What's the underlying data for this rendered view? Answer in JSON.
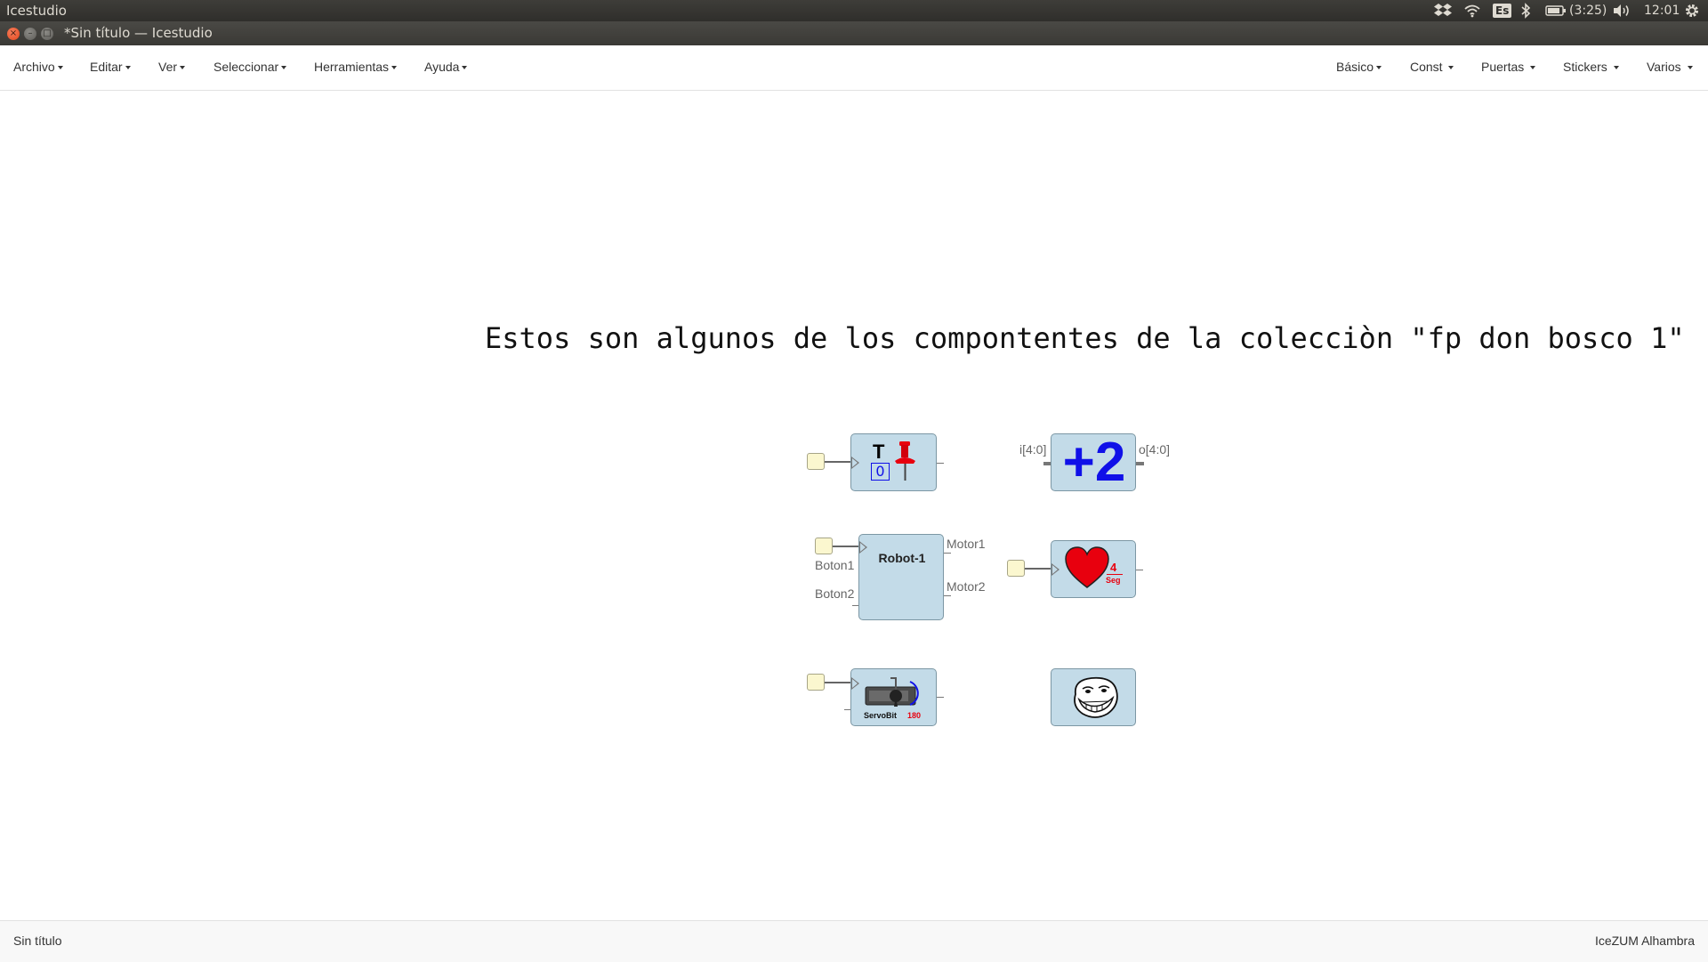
{
  "system_panel": {
    "app_name": "Icestudio",
    "keyboard_layout": "Es",
    "battery": "(3:25)",
    "clock": "12:01"
  },
  "window": {
    "title": "*Sin título — Icestudio",
    "close_glyph": "×",
    "minimize_glyph": "–",
    "maximize_glyph": "□"
  },
  "menubar": {
    "left": [
      {
        "label": "Archivo"
      },
      {
        "label": "Editar"
      },
      {
        "label": "Ver"
      },
      {
        "label": "Seleccionar"
      },
      {
        "label": "Herramientas"
      },
      {
        "label": "Ayuda"
      }
    ],
    "right": [
      {
        "label": "Básico"
      },
      {
        "label": "Const "
      },
      {
        "label": "Puertas "
      },
      {
        "label": "Stickers "
      },
      {
        "label": "Varios "
      }
    ]
  },
  "canvas": {
    "title": "Estos son algunos de los compontentes de la colecciòn \"fp don bosco 1\"",
    "blocks": {
      "toggle": {
        "t_label": "T",
        "value_label": "0",
        "icon": "pushpin-icon"
      },
      "adder": {
        "label": "+2",
        "in_port": "i[4:0]",
        "out_port": "o[4:0]"
      },
      "robot": {
        "name": "Robot-1",
        "in_ports": [
          "Boton1",
          "Boton2"
        ],
        "out_ports": [
          "Motor1",
          "Motor2"
        ]
      },
      "heart": {
        "number": "4",
        "unit": "Seg",
        "icon": "heart-icon"
      },
      "servo": {
        "name": "ServoBit",
        "angle": "180",
        "icon": "servo-icon"
      },
      "troll": {
        "icon": "trollface-icon"
      }
    }
  },
  "footer": {
    "filename": "Sin título",
    "board": "IceZUM Alhambra"
  },
  "colors": {
    "block_fill": "#c3dbe8",
    "input_fill": "#fbf7cf",
    "adder_text": "#1010e8",
    "heart": "#e8000e"
  }
}
